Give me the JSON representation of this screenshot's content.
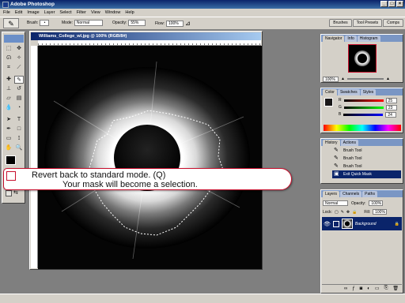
{
  "app": {
    "title": "Adobe Photoshop"
  },
  "window_controls": {
    "minimize": "_",
    "maximize": "□",
    "close": "×"
  },
  "menu": [
    "File",
    "Edit",
    "Image",
    "Layer",
    "Select",
    "Filter",
    "View",
    "Window",
    "Help"
  ],
  "options": {
    "brush_label": "Brush:",
    "mode_label": "Mode:",
    "mode_value": "Normal",
    "opacity_label": "Opacity:",
    "opacity_value": "55%",
    "flow_label": "Flow:",
    "flow_value": "100%"
  },
  "palette_well_tabs": [
    "Brushes",
    "Tool Presets",
    "Comps"
  ],
  "document": {
    "title": "Williams_College_wl.jpg @ 100% (RGB/8#)"
  },
  "navigator": {
    "tabs": [
      "Navigator",
      "Info",
      "Histogram"
    ],
    "zoom": "100%"
  },
  "color": {
    "tabs": [
      "Color",
      "Swatches",
      "Styles"
    ],
    "channels": [
      {
        "label": "R",
        "value": "25"
      },
      {
        "label": "G",
        "value": "23"
      },
      {
        "label": "B",
        "value": "24"
      }
    ]
  },
  "history": {
    "tabs": [
      "History",
      "Actions"
    ],
    "items": [
      "Brush Tool",
      "Brush Tool",
      "Brush Tool",
      "Exit Quick Mask"
    ],
    "selected_index": 3
  },
  "layers": {
    "tabs": [
      "Layers",
      "Channels",
      "Paths"
    ],
    "blend_mode": "Normal",
    "opacity_label": "Opacity:",
    "opacity_value": "100%",
    "lock_label": "Lock:",
    "fill_label": "Fill:",
    "fill_value": "100%",
    "layer_name": "Background"
  },
  "callout": {
    "line1": "Revert back to standard mode. (Q)",
    "line2": "Your mask will become a selection."
  },
  "colors": {
    "title_blue": "#0a246a",
    "selection_blue": "#0a246a",
    "callout_border": "#c8102e",
    "panel_gray": "#d4d0c8"
  }
}
